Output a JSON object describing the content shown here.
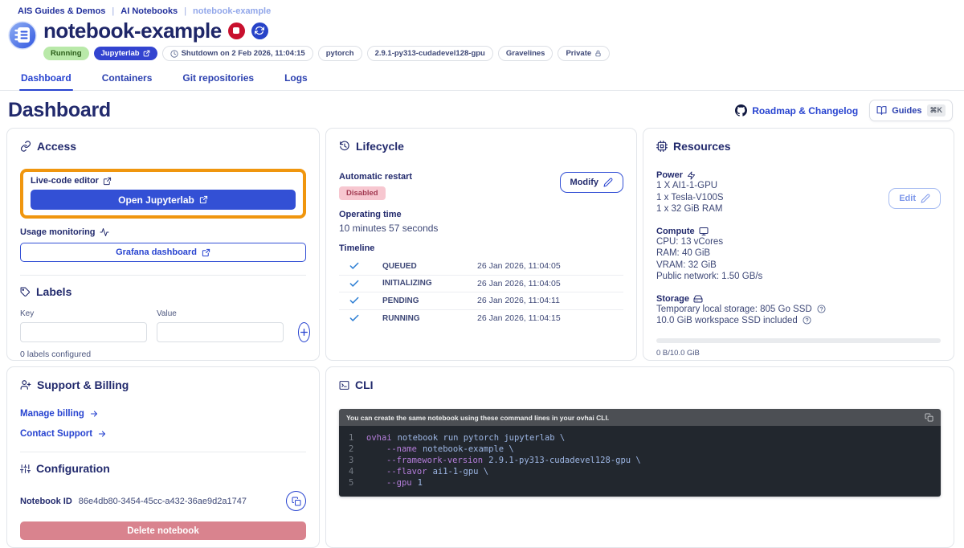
{
  "breadcrumb": {
    "items": [
      "AIS Guides & Demos",
      "AI Notebooks",
      "notebook-example"
    ],
    "separator": "|"
  },
  "header": {
    "title": "notebook-example",
    "status_badge": "Running",
    "app_badge": "Jupyterlab",
    "shutdown_badge": "Shutdown on 2 Feb 2026, 11:04:15",
    "framework_badge": "pytorch",
    "version_badge": "2.9.1-py313-cudadevel128-gpu",
    "region_badge": "Gravelines",
    "privacy_badge": "Private"
  },
  "tabs": [
    {
      "label": "Dashboard"
    },
    {
      "label": "Containers"
    },
    {
      "label": "Git repositories"
    },
    {
      "label": "Logs"
    }
  ],
  "page": {
    "title": "Dashboard",
    "roadmap_link": "Roadmap & Changelog",
    "guides_button": "Guides",
    "guides_shortcut": "⌘K"
  },
  "access": {
    "title": "Access",
    "live_code_label": "Live-code editor",
    "open_button": "Open Jupyterlab",
    "usage_label": "Usage monitoring",
    "grafana_button": "Grafana dashboard"
  },
  "labels_section": {
    "title": "Labels",
    "key_label": "Key",
    "value_label": "Value",
    "count_text": "0 labels configured"
  },
  "lifecycle": {
    "title": "Lifecycle",
    "auto_restart_label": "Automatic restart",
    "auto_restart_value": "Disabled",
    "modify_button": "Modify",
    "operating_time_label": "Operating time",
    "operating_time_value": "10 minutes 57 seconds",
    "timeline_label": "Timeline",
    "timeline": [
      {
        "state": "QUEUED",
        "time": "26 Jan 2026, 11:04:05"
      },
      {
        "state": "INITIALIZING",
        "time": "26 Jan 2026, 11:04:05"
      },
      {
        "state": "PENDING",
        "time": "26 Jan 2026, 11:04:11"
      },
      {
        "state": "RUNNING",
        "time": "26 Jan 2026, 11:04:15"
      }
    ]
  },
  "resources": {
    "title": "Resources",
    "edit_button": "Edit",
    "power": {
      "label": "Power",
      "lines": [
        "1 X AI1-1-GPU",
        "1 x Tesla-V100S",
        "1 x 32 GiB RAM"
      ]
    },
    "compute": {
      "label": "Compute",
      "lines": [
        "CPU: 13 vCores",
        "RAM: 40 GiB",
        "VRAM: 32 GiB",
        "Public network: 1.50 GB/s"
      ]
    },
    "storage": {
      "label": "Storage",
      "line1": "Temporary local storage: 805 Go SSD",
      "line2": "10.0 GiB workspace SSD included",
      "usage_text": "0 B/10.0 GiB",
      "usage_percent": 0
    }
  },
  "support": {
    "title": "Support & Billing",
    "billing_link": "Manage billing",
    "support_link": "Contact Support"
  },
  "configuration": {
    "title": "Configuration",
    "notebook_id_label": "Notebook ID",
    "notebook_id": "86e4db80-3454-45cc-a432-36ae9d2a1747",
    "delete_button": "Delete notebook"
  },
  "cli": {
    "title": "CLI",
    "banner": "You can create the same notebook using these command lines in your ovhai CLI.",
    "lines": [
      {
        "n": "1",
        "kw": "ovhai",
        "rest": "notebook run pytorch jupyterlab \\"
      },
      {
        "n": "2",
        "kw": "--name",
        "rest": "notebook-example \\"
      },
      {
        "n": "3",
        "kw": "--framework-version",
        "rest": "2.9.1-py313-cudadevel128-gpu \\"
      },
      {
        "n": "4",
        "kw": "--flavor",
        "rest": "ai1-1-gpu \\"
      },
      {
        "n": "5",
        "kw": "--gpu",
        "rest": "1"
      }
    ]
  },
  "colors": {
    "accent_blue": "#3350d5",
    "heading_navy": "#222a6d",
    "body_text": "#3e4877",
    "running_green_bg": "#b9e9a9",
    "running_green_text": "#2c5e1a",
    "disabled_pink_bg": "#f7c7d0",
    "disabled_pink_text": "#a23a52",
    "delete_red": "#d9838e",
    "highlight_orange": "#f0960e",
    "stop_red": "#c8102e",
    "code_bg": "#22272e",
    "code_header_bg": "#4c4f54",
    "code_keyword": "#b57edb",
    "code_text": "#9db6e4"
  }
}
